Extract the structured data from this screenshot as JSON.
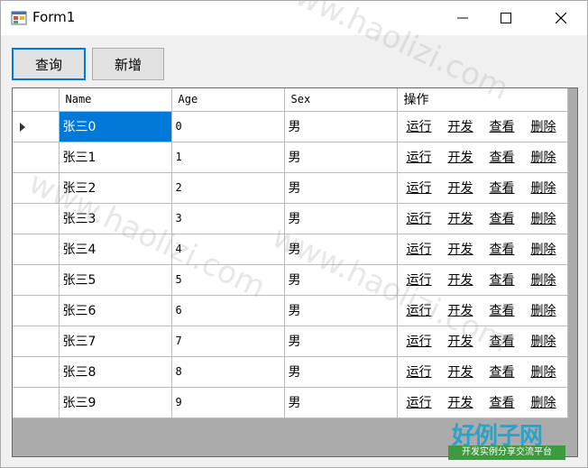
{
  "window": {
    "title": "Form1"
  },
  "toolbar": {
    "query_label": "查询",
    "add_label": "新增"
  },
  "grid": {
    "columns": [
      "Name",
      "Age",
      "Sex",
      "操作"
    ],
    "rows": [
      {
        "name": "张三0",
        "age": "0",
        "sex": "男"
      },
      {
        "name": "张三1",
        "age": "1",
        "sex": "男"
      },
      {
        "name": "张三2",
        "age": "2",
        "sex": "男"
      },
      {
        "name": "张三3",
        "age": "3",
        "sex": "男"
      },
      {
        "name": "张三4",
        "age": "4",
        "sex": "男"
      },
      {
        "name": "张三5",
        "age": "5",
        "sex": "男"
      },
      {
        "name": "张三6",
        "age": "6",
        "sex": "男"
      },
      {
        "name": "张三7",
        "age": "7",
        "sex": "男"
      },
      {
        "name": "张三8",
        "age": "8",
        "sex": "男"
      },
      {
        "name": "张三9",
        "age": "9",
        "sex": "男"
      }
    ],
    "actions": [
      "运行",
      "开发",
      "查看",
      "删除"
    ],
    "selected_row": 0
  },
  "watermark": {
    "text": "www.haolizi.com",
    "logo_text": "好例子网",
    "logo_sub": "开发实例分享交流平台"
  },
  "colors": {
    "selection": "#0078d7",
    "focus_border": "#0078d7"
  },
  "icons": {
    "app": "winforms-app-icon",
    "minimize": "minimize-icon",
    "maximize": "maximize-icon",
    "close": "close-icon",
    "row_indicator": "row-indicator-arrow-icon"
  }
}
